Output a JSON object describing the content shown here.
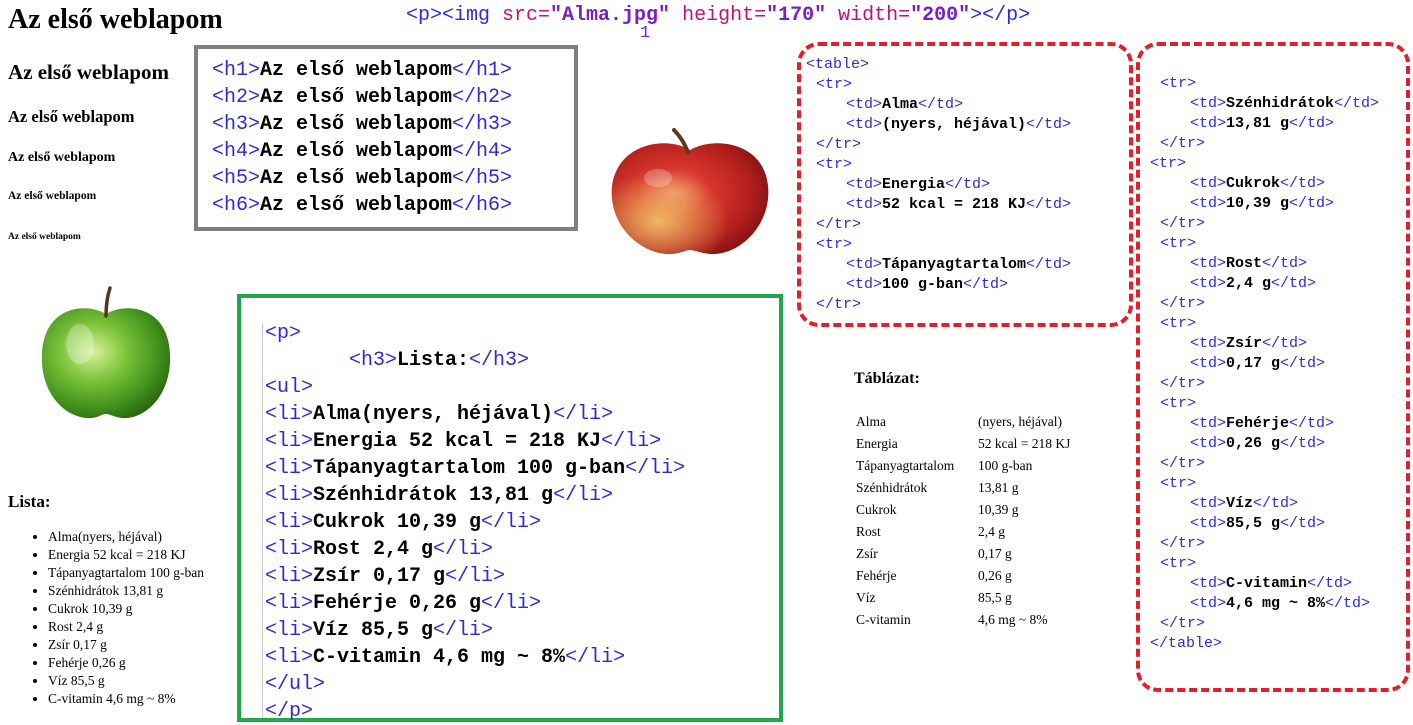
{
  "headings": {
    "h1": "Az első weblapom",
    "h2": "Az első weblapom",
    "h3": "Az első weblapom",
    "h4": "Az első weblapom",
    "h5": "Az első weblapom",
    "h6": "Az első weblapom"
  },
  "gray_code": [
    {
      "open": "<h1>",
      "text": "Az első weblapom",
      "close": "</h1>"
    },
    {
      "open": "<h2>",
      "text": "Az első weblapom",
      "close": "</h2>"
    },
    {
      "open": "<h3>",
      "text": "Az első weblapom",
      "close": "</h3>"
    },
    {
      "open": "<h4>",
      "text": "Az első weblapom",
      "close": "</h4>"
    },
    {
      "open": "<h5>",
      "text": "Az első weblapom",
      "close": "</h5>"
    },
    {
      "open": "<h6>",
      "text": "Az első weblapom",
      "close": "</h6>"
    }
  ],
  "img_code": {
    "open": "<p><img ",
    "src_attr": "src=",
    "src_val": "\"Alma.jpg\"",
    "height_attr": "height=",
    "height_val": "\"170\"",
    "width_attr": "width=",
    "width_val": "\"200\"",
    "close": "></p>",
    "annotation": "1"
  },
  "apples": {
    "red": "red-apple",
    "green": "green-apple"
  },
  "green_code": {
    "p_open": "<p>",
    "h3_open": "<h3>",
    "h3_text": "Lista:",
    "h3_close": "</h3>",
    "ul_open": "<ul>",
    "li_open": "<li>",
    "li_close": "</li>",
    "items": [
      "Alma(nyers, héjával)",
      "Energia 52 kcal = 218 KJ",
      "Tápanyagtartalom 100 g-ban",
      "Szénhidrátok 13,81 g",
      "Cukrok 10,39 g",
      "Rost 2,4 g",
      "Zsír 0,17 g",
      "Fehérje 0,26 g",
      "Víz 85,5 g",
      "C-vitamin 4,6 mg ~ 8%"
    ],
    "ul_close": "</ul>",
    "p_close": "</p>"
  },
  "lista": {
    "title": "Lista:",
    "items": [
      "Alma(nyers, héjával)",
      "Energia 52 kcal = 218 KJ",
      "Tápanyagtartalom 100 g-ban",
      "Szénhidrátok 13,81 g",
      "Cukrok 10,39 g",
      "Rost 2,4 g",
      "Zsír 0,17 g",
      "Fehérje 0,26 g",
      "Víz 85,5 g",
      "C-vitamin 4,6 mg ~ 8%"
    ]
  },
  "table_code_1": {
    "table_open": "<table>",
    "tr_open": "<tr>",
    "tr_close": "</tr>",
    "td_open": "<td>",
    "td_close": "</td>",
    "rows": [
      [
        "Alma",
        "(nyers, héjával)"
      ],
      [
        "Energia",
        "52 kcal = 218 KJ"
      ],
      [
        "Tápanyagtartalom",
        "100 g-ban"
      ]
    ]
  },
  "table_code_2": {
    "rows": [
      [
        "Szénhidrátok",
        "13,81 g"
      ],
      [
        "Cukrok",
        "10,39 g"
      ],
      [
        "Rost",
        "2,4 g"
      ],
      [
        "Zsír",
        "0,17 g"
      ],
      [
        "Fehérje",
        "0,26 g"
      ],
      [
        "Víz",
        "85,5 g"
      ],
      [
        "C-vitamin",
        "4,6 mg ~ 8%"
      ]
    ],
    "table_close": "</table>"
  },
  "table_rendered": {
    "title": "Táblázat:",
    "rows": [
      [
        "Alma",
        "(nyers, héjával)"
      ],
      [
        "Energia",
        "52 kcal = 218 KJ"
      ],
      [
        "Tápanyagtartalom",
        "100 g-ban"
      ],
      [
        "Szénhidrátok",
        "13,81 g"
      ],
      [
        "Cukrok",
        "10,39 g"
      ],
      [
        "Rost",
        "2,4 g"
      ],
      [
        "Zsír",
        "0,17 g"
      ],
      [
        "Fehérje",
        "0,26 g"
      ],
      [
        "Víz",
        "85,5 g"
      ],
      [
        "C-vitamin",
        "4,6 mg ~ 8%"
      ]
    ]
  },
  "colors": {
    "tag": "#2b2bd9",
    "attr": "#c0117a",
    "value": "#7a1ec8",
    "gray_border": "#7f7f7f",
    "green_border": "#22a84a",
    "red_border": "#e0202a"
  }
}
